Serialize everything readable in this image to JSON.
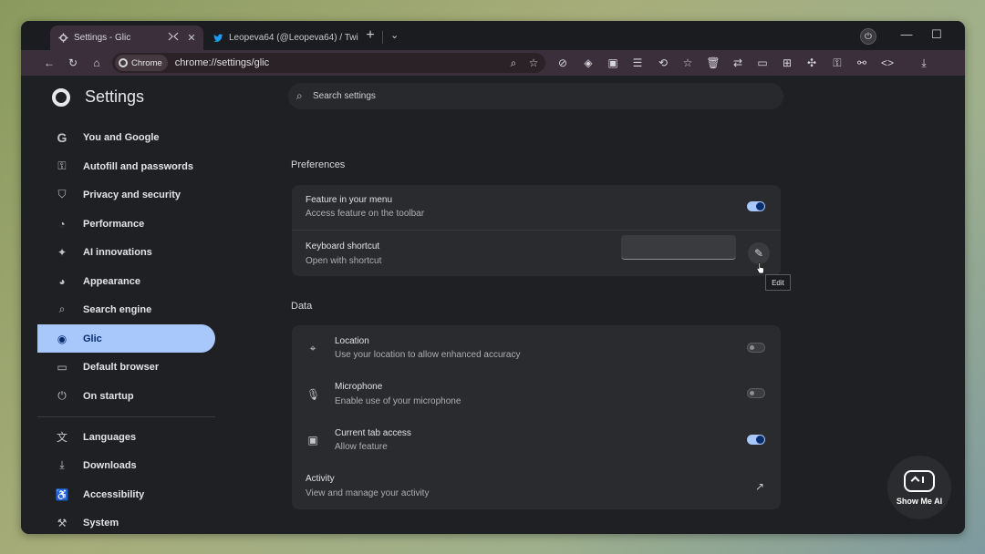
{
  "tabs": [
    {
      "title": "Settings - Glic",
      "icon": "gear-icon",
      "active": true
    },
    {
      "title": "Leopeva64 (@Leopeva64) / Twi",
      "icon": "twitter-icon",
      "active": false
    }
  ],
  "toolbar": {
    "chip_label": "Chrome",
    "url": "chrome://settings/glic"
  },
  "settings": {
    "app_title": "Settings",
    "search_placeholder": "Search settings"
  },
  "nav": {
    "items": [
      {
        "label": "You and Google",
        "icon": "google-icon"
      },
      {
        "label": "Autofill and passwords",
        "icon": "key-icon"
      },
      {
        "label": "Privacy and security",
        "icon": "shield-icon"
      },
      {
        "label": "Performance",
        "icon": "speedometer-icon"
      },
      {
        "label": "AI innovations",
        "icon": "sparkle-icon"
      },
      {
        "label": "Appearance",
        "icon": "palette-icon"
      },
      {
        "label": "Search engine",
        "icon": "search-icon"
      },
      {
        "label": "Glic",
        "icon": "glic-icon",
        "selected": true
      },
      {
        "label": "Default browser",
        "icon": "browser-window-icon"
      },
      {
        "label": "On startup",
        "icon": "power-icon"
      },
      {
        "label": "Languages",
        "icon": "translate-icon"
      },
      {
        "label": "Downloads",
        "icon": "download-icon"
      },
      {
        "label": "Accessibility",
        "icon": "accessibility-icon"
      },
      {
        "label": "System",
        "icon": "wrench-icon"
      }
    ]
  },
  "preferences": {
    "title": "Preferences",
    "feature_menu": {
      "title": "Feature in your menu",
      "subtitle": "Access feature on the toolbar",
      "enabled": true
    },
    "keyboard_shortcut": {
      "title": "Keyboard shortcut",
      "subtitle": "Open with shortcut",
      "value": ""
    },
    "edit_tooltip": "Edit"
  },
  "data_section": {
    "title": "Data",
    "location": {
      "title": "Location",
      "subtitle": "Use your location to allow enhanced accuracy",
      "enabled": false
    },
    "microphone": {
      "title": "Microphone",
      "subtitle": "Enable use of your microphone",
      "enabled": false
    },
    "tab_access": {
      "title": "Current tab access",
      "subtitle": "Allow feature",
      "enabled": true
    },
    "activity": {
      "title": "Activity",
      "subtitle": "View and manage your activity"
    }
  },
  "watermark": {
    "text": "Show Me AI"
  },
  "colors": {
    "accent": "#a8c7fa",
    "toolbar": "#3b2f3c",
    "background": "#1f2023"
  }
}
